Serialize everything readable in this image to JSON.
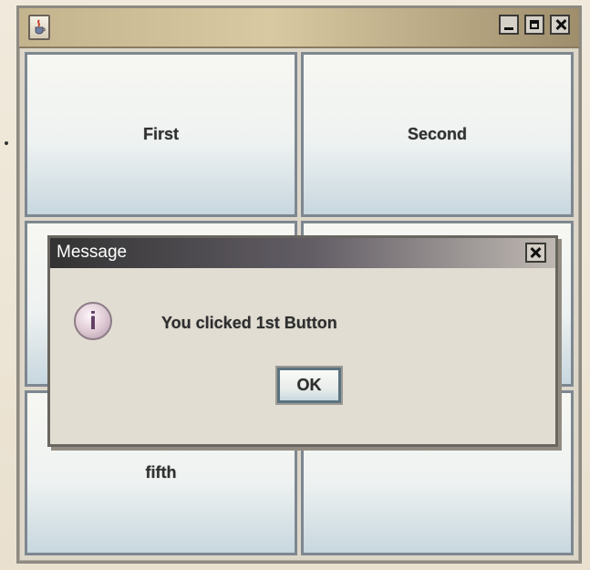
{
  "app": {
    "window_title": "",
    "controls": {
      "minimize": "",
      "maximize": "",
      "close": ""
    }
  },
  "buttons": {
    "first": "First",
    "second": "Second",
    "fifth": "fifth"
  },
  "dialog": {
    "title": "Message",
    "message": "You clicked  1st Button",
    "ok_label": "OK",
    "icon": "i"
  },
  "icons": {
    "app": "java-icon",
    "information": "info-icon"
  }
}
